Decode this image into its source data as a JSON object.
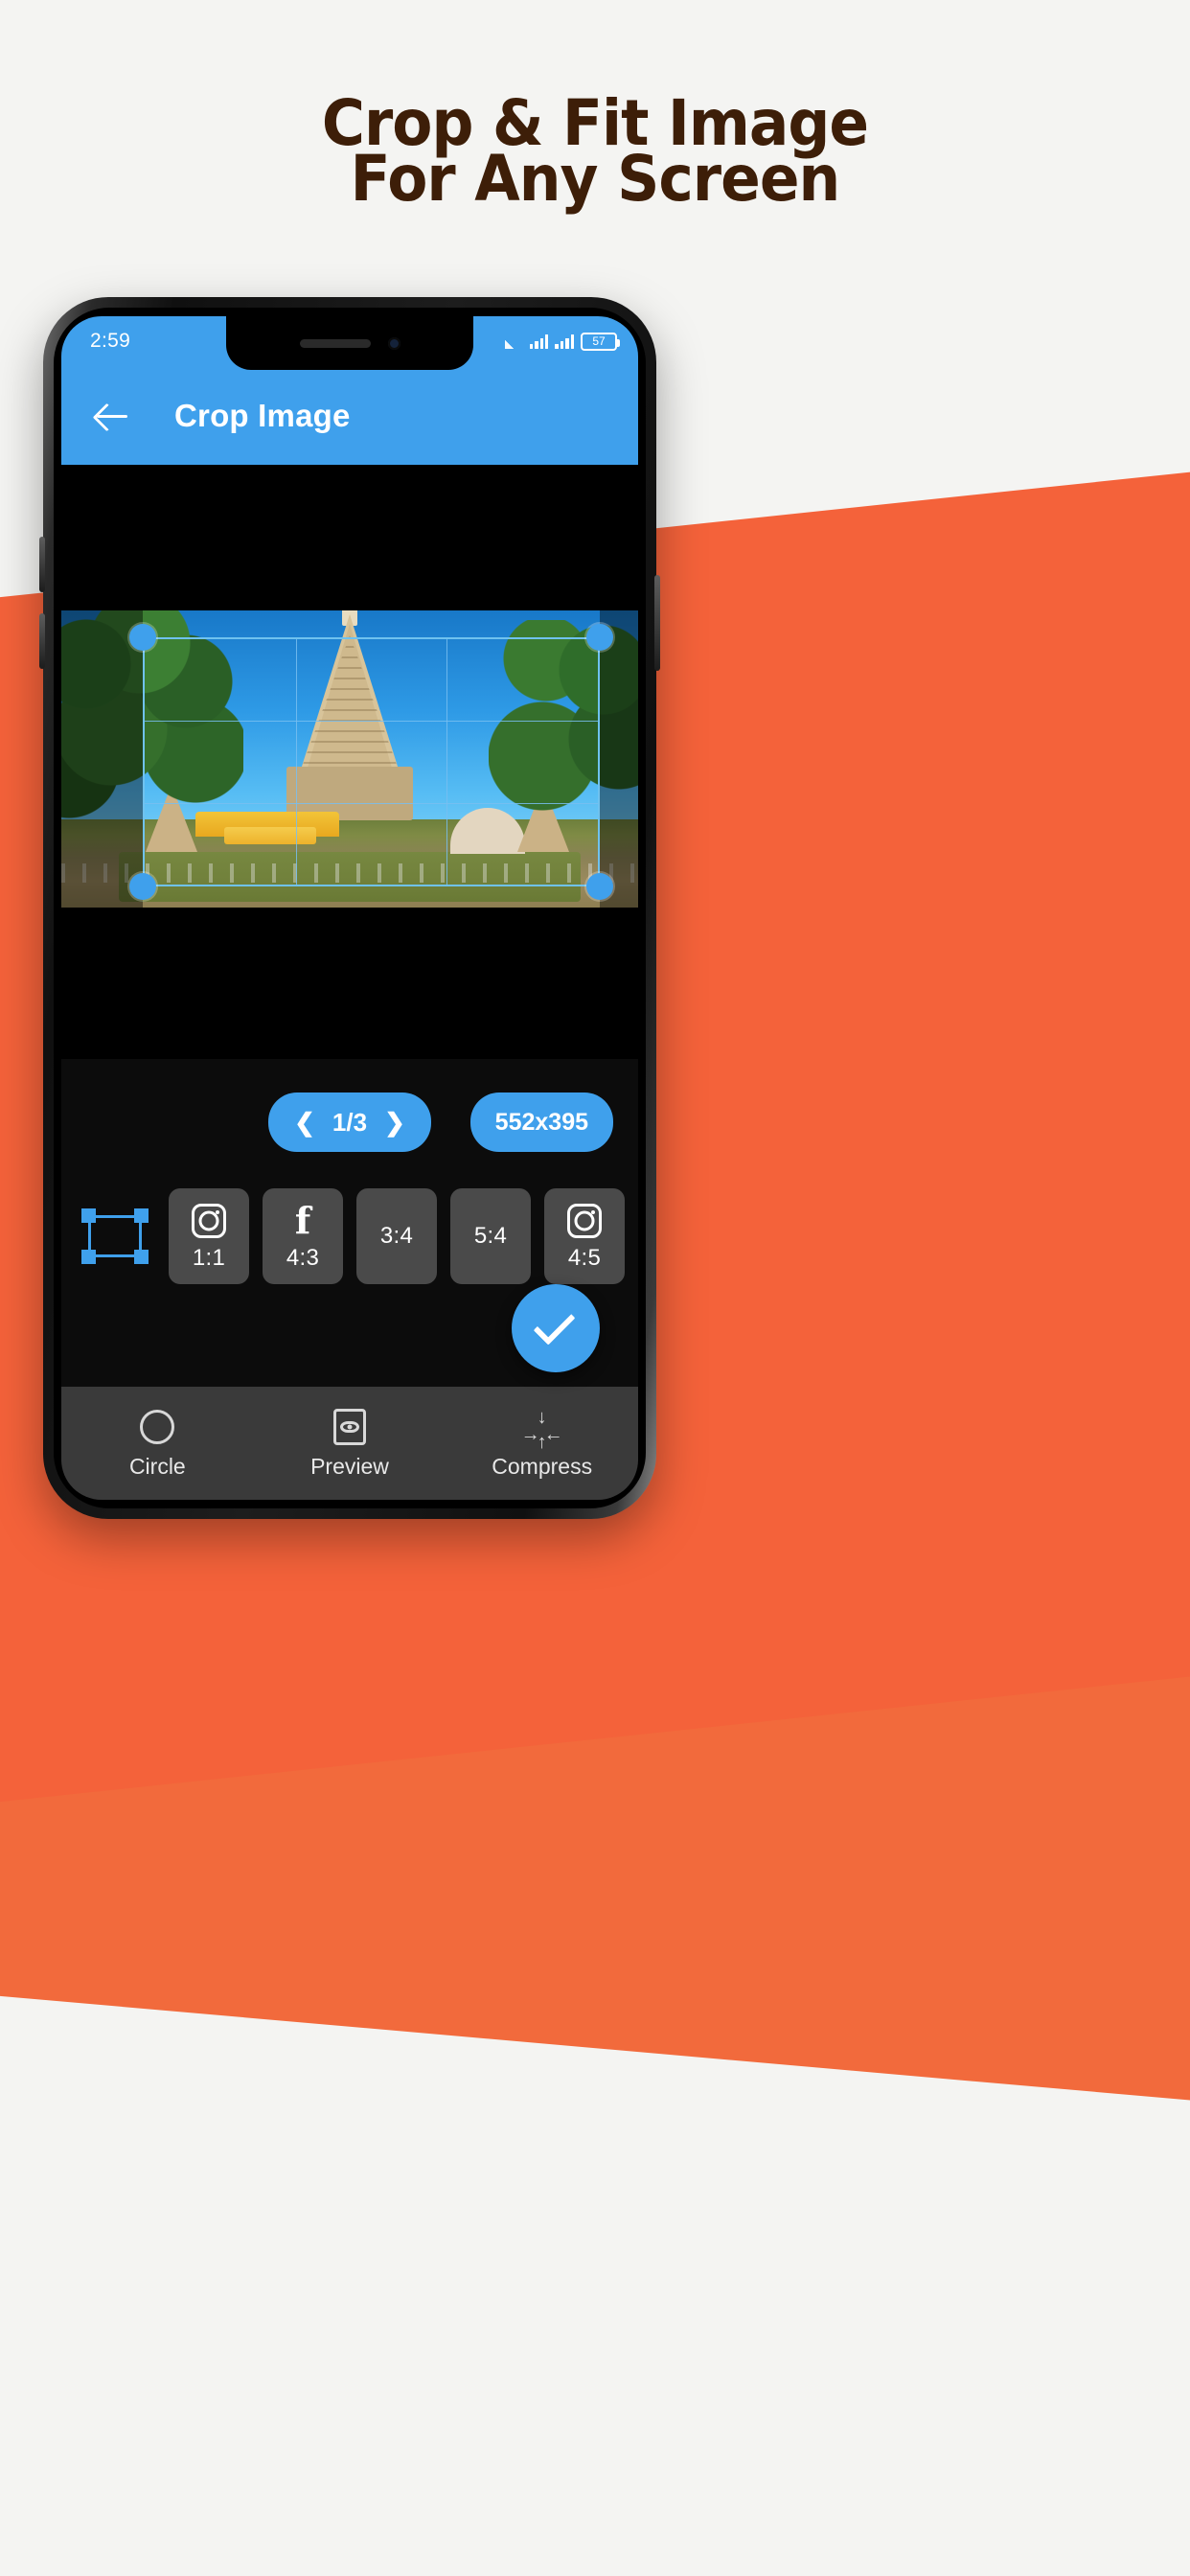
{
  "promo": {
    "headline_line1": "Crop & Fit Image",
    "headline_line2": "For Any Screen",
    "headline_color": "#3d1e08",
    "background_color": "#f4f4f2",
    "accent_color": "#f4623a"
  },
  "phone": {
    "status_bar": {
      "time": "2:59",
      "battery_percent": "57",
      "wifi_icon": "wifi-icon",
      "signal_icon": "signal-bars-icon"
    },
    "app_bar": {
      "back_icon": "back-arrow-icon",
      "title": "Crop Image",
      "color": "#3fa0ec"
    },
    "editor": {
      "pager": {
        "prev_icon": "chevron-left-icon",
        "next_icon": "chevron-right-icon",
        "counter": "1/3"
      },
      "size_badge": "552x395",
      "aspect_ratios": [
        {
          "name": "free",
          "icon": "free-crop-icon",
          "label": "",
          "selected": true
        },
        {
          "name": "instagram-1-1",
          "icon": "instagram-icon",
          "label": "1:1",
          "selected": false
        },
        {
          "name": "facebook-4-3",
          "icon": "facebook-icon",
          "label": "4:3",
          "selected": false
        },
        {
          "name": "ratio-3-4",
          "icon": "",
          "label": "3:4",
          "selected": false
        },
        {
          "name": "ratio-5-4",
          "icon": "",
          "label": "5:4",
          "selected": false
        },
        {
          "name": "instagram-4-5",
          "icon": "instagram-icon",
          "label": "4:5",
          "selected": false
        }
      ],
      "confirm_icon": "check-icon"
    },
    "bottom_toolbar": [
      {
        "name": "circle",
        "icon": "circle-icon",
        "label": "Circle"
      },
      {
        "name": "preview",
        "icon": "preview-eye-icon",
        "label": "Preview"
      },
      {
        "name": "compress",
        "icon": "compress-arrows-icon",
        "label": "Compress"
      }
    ]
  }
}
